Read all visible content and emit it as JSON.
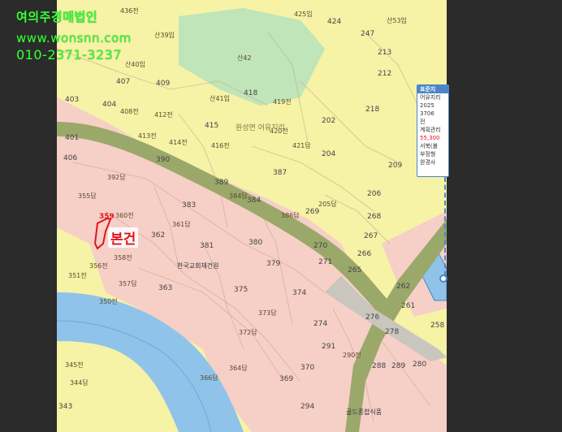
{
  "watermark": {
    "line1": "여의주경매법인",
    "line2": "www.wonsnn.com",
    "line3": "010-2371-3237"
  },
  "subject": {
    "label": "본건",
    "lot": "359"
  },
  "legend": {
    "title": "표준지",
    "rows": [
      "어유지리",
      "2025",
      "3706",
      "전",
      "계획관리",
      "55,300",
      "서북(불",
      "부정형",
      "완경사"
    ]
  },
  "places": {
    "church": "한국교회재건원",
    "food": "골드종합식품",
    "village": "원성면 어유지리"
  },
  "parcels": {
    "n1": "436전",
    "n2": "425임",
    "n3": "424",
    "n4": "산39임",
    "n5": "산53임",
    "n6": "247",
    "n7": "213",
    "n8": "212",
    "n9": "407",
    "n10": "409",
    "n11": "418",
    "n12": "403",
    "n13": "404",
    "n14": "산41임",
    "n15": "415",
    "n16": "202",
    "n17": "218",
    "n18": "401",
    "n19": "413전",
    "n20": "414전",
    "n21": "390",
    "n22": "204",
    "n23": "209",
    "n24": "406",
    "n25": "392답",
    "n26": "389",
    "n27": "387",
    "n28": "206",
    "n29": "383",
    "n30": "384",
    "n31": "269",
    "n32": "268",
    "n33": "362",
    "n34": "381",
    "n35": "380",
    "n36": "270",
    "n37": "267",
    "n38": "266",
    "n39": "379",
    "n40": "271",
    "n41": "265",
    "n42": "363",
    "n43": "375",
    "n44": "374",
    "n45": "262",
    "n46": "261",
    "n47": "274",
    "n48": "276",
    "n49": "278",
    "n50": "258",
    "n51": "291",
    "n52": "370",
    "n53": "288",
    "n54": "289",
    "n55": "280",
    "n56": "369",
    "n57": "294",
    "n58": "345전",
    "n59": "344답",
    "n60": "343",
    "n61": "356전",
    "n62": "351전",
    "n63": "357답",
    "n64": "350전",
    "n65": "358전",
    "n66": "361답",
    "n67": "360전",
    "n68": "355답",
    "n69": "산42",
    "n70": "419전",
    "n71": "420전",
    "n72": "421답",
    "n73": "386답",
    "n74": "372답",
    "n75": "373답",
    "n76": "366답",
    "n77": "364답",
    "n78": "290전",
    "n79": "384답",
    "n80": "205답",
    "n81": "산40임",
    "n82": "412전",
    "n83": "408전",
    "n84": "416전"
  },
  "colors": {
    "yellow_zone": "#f6f2a6",
    "pink_zone": "#f6cfc7",
    "green_zone": "#bfe5b9",
    "road": "#9aa86a",
    "river": "#8fc3ea",
    "subject_outline": "#e0141e",
    "watermark": "#3aff3a"
  }
}
